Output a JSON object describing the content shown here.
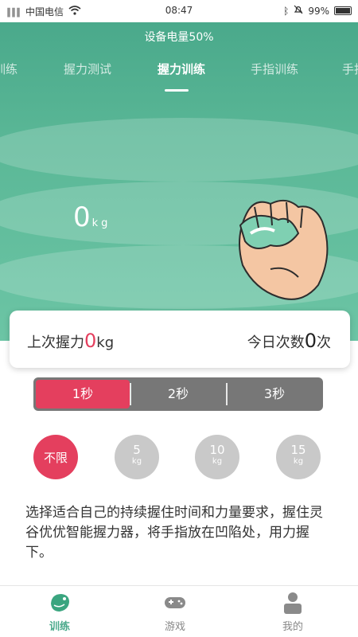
{
  "status_bar": {
    "signal": "∥∥∥",
    "carrier": "中国电信",
    "time": "08:47",
    "battery": "99%"
  },
  "header": {
    "device_battery": "设备电量50%",
    "tabs": [
      {
        "label": "训练"
      },
      {
        "label": "握力测试"
      },
      {
        "label": "握力训练"
      },
      {
        "label": "手指训练"
      },
      {
        "label": "手指"
      }
    ]
  },
  "weight": {
    "value": "0",
    "unit": "kg"
  },
  "info": {
    "last_grip_label": "上次握力",
    "last_grip_value": "0",
    "last_grip_unit": "kg",
    "today_label": "今日次数",
    "today_value": "0",
    "today_unit": "次"
  },
  "durations": [
    {
      "label": "1秒",
      "active": true
    },
    {
      "label": "2秒",
      "active": false
    },
    {
      "label": "3秒",
      "active": false
    }
  ],
  "forces": [
    {
      "num": "不限",
      "unit": ""
    },
    {
      "num": "5",
      "unit": "kg"
    },
    {
      "num": "10",
      "unit": "kg"
    },
    {
      "num": "15",
      "unit": "kg"
    }
  ],
  "instruction": "选择适合自己的持续握住时间和力量要求，握住灵谷优优智能握力器，将手指放在凹陷处，用力握下。",
  "nav": [
    {
      "label": "训练",
      "icon": "train-icon"
    },
    {
      "label": "游戏",
      "icon": "gamepad-icon"
    },
    {
      "label": "我的",
      "icon": "profile-icon"
    }
  ],
  "colors": {
    "accent": "#e43f5e",
    "brand": "#4aa98b"
  }
}
